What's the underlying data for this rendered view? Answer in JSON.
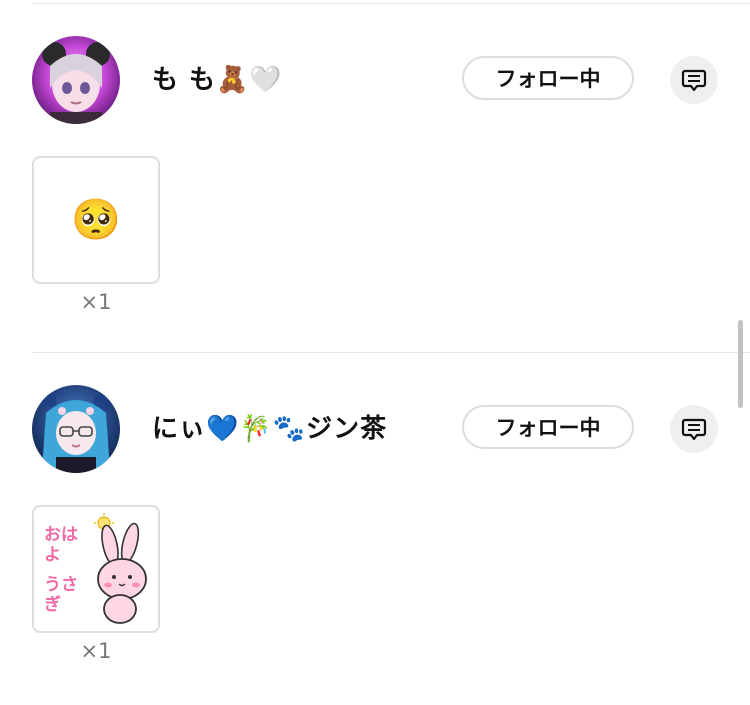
{
  "entries": [
    {
      "username": "も も🧸🤍",
      "follow_label": "フォロー中",
      "sticker_emoji": "🥺",
      "sticker_count": "×1"
    },
    {
      "username": "にぃ💙🎋🐾ジン茶",
      "follow_label": "フォロー中",
      "sticker_text_1": "おはよ",
      "sticker_text_2": "うさぎ",
      "sticker_count": "×1"
    }
  ],
  "colors": {
    "follow_border": "#dcdcdc",
    "message_bg": "#efefef",
    "count_text": "#777777",
    "sticker_pink": "#f06aa8"
  },
  "icons": {
    "message": "message-icon"
  }
}
